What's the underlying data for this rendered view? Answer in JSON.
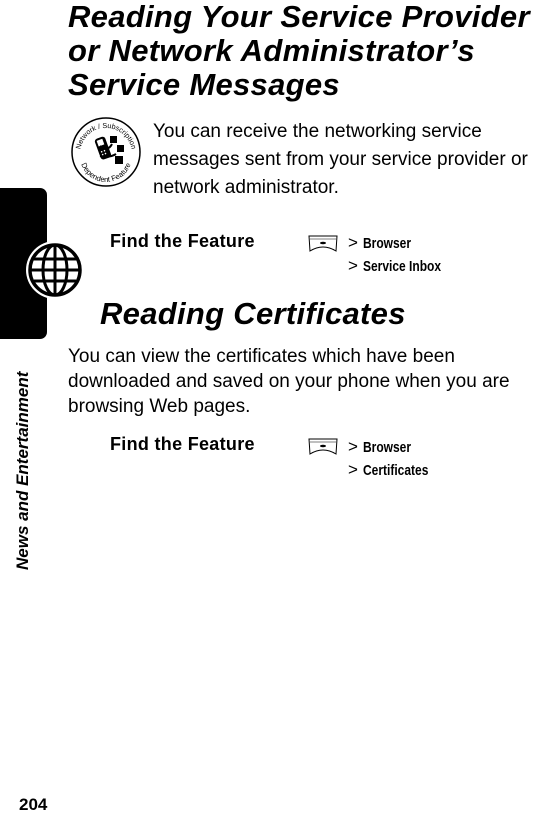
{
  "section1": {
    "title": "Reading Your Service Provider or Network Administrator’s Service Messages",
    "badge": {
      "icon": "network-subscription-dependent-feature-icon",
      "top_text": "Network / Subscription",
      "bottom_text": "Dependent Feature"
    },
    "intro": "You can receive the networking service messages sent from your service provider or network administrator.",
    "find_the_feature": {
      "label": "Find the Feature",
      "key_icon": "menu-key-icon",
      "steps": [
        {
          "sep": ">",
          "item": "Browser"
        },
        {
          "sep": ">",
          "item": "Service Inbox"
        }
      ]
    }
  },
  "section2": {
    "title": "Reading Certificates",
    "intro": "You can view the certificates which have been downloaded and saved on your phone when you are browsing Web pages.",
    "find_the_feature": {
      "label": "Find the Feature",
      "key_icon": "menu-key-icon",
      "steps": [
        {
          "sep": ">",
          "item": "Browser"
        },
        {
          "sep": ">",
          "item": "Certificates"
        }
      ]
    }
  },
  "sidebar": {
    "chapter_label": "News and Entertainment",
    "tab_icon": "globe-icon",
    "tab_color": "#000000"
  },
  "footer": {
    "page_number": "204"
  }
}
